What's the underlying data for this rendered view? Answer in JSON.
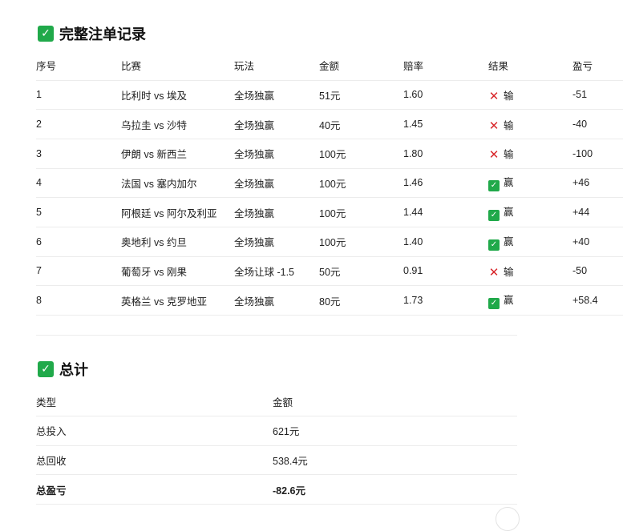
{
  "records_title": "完整注单记录",
  "records_headers": [
    "序号",
    "比赛",
    "玩法",
    "金额",
    "赔率",
    "结果",
    "盈亏"
  ],
  "records": [
    {
      "no": "1",
      "match": "比利时 vs 埃及",
      "play": "全场独赢",
      "amount": "51元",
      "odds": "1.60",
      "result": "输",
      "result_icon": "cross-icon",
      "pnl": "-51"
    },
    {
      "no": "2",
      "match": "乌拉圭 vs 沙特",
      "play": "全场独赢",
      "amount": "40元",
      "odds": "1.45",
      "result": "输",
      "result_icon": "cross-icon",
      "pnl": "-40"
    },
    {
      "no": "3",
      "match": "伊朗 vs 新西兰",
      "play": "全场独赢",
      "amount": "100元",
      "odds": "1.80",
      "result": "输",
      "result_icon": "cross-icon",
      "pnl": "-100"
    },
    {
      "no": "4",
      "match": "法国 vs 塞内加尔",
      "play": "全场独赢",
      "amount": "100元",
      "odds": "1.46",
      "result": "赢",
      "result_icon": "check-icon",
      "pnl": "+46"
    },
    {
      "no": "5",
      "match": "阿根廷 vs 阿尔及利亚",
      "play": "全场独赢",
      "amount": "100元",
      "odds": "1.44",
      "result": "赢",
      "result_icon": "check-icon",
      "pnl": "+44"
    },
    {
      "no": "6",
      "match": "奥地利 vs 约旦",
      "play": "全场独赢",
      "amount": "100元",
      "odds": "1.40",
      "result": "赢",
      "result_icon": "check-icon",
      "pnl": "+40"
    },
    {
      "no": "7",
      "match": "葡萄牙 vs 刚果",
      "play": "全场让球 -1.5",
      "amount": "50元",
      "odds": "0.91",
      "result": "输",
      "result_icon": "cross-icon",
      "pnl": "-50"
    },
    {
      "no": "8",
      "match": "英格兰 vs 克罗地亚",
      "play": "全场独赢",
      "amount": "80元",
      "odds": "1.73",
      "result": "赢",
      "result_icon": "check-icon",
      "pnl": "+58.4"
    }
  ],
  "totals_title": "总计",
  "totals_headers": [
    "类型",
    "金额"
  ],
  "totals": [
    {
      "type": "总投入",
      "amount": "621元",
      "bold": false
    },
    {
      "type": "总回收",
      "amount": "538.4元",
      "bold": false
    },
    {
      "type": "总盈亏",
      "amount": "-82.6元",
      "bold": true
    }
  ],
  "colors": {
    "win": "#20a94a",
    "lose": "#d8262a",
    "divider": "#ececec"
  }
}
